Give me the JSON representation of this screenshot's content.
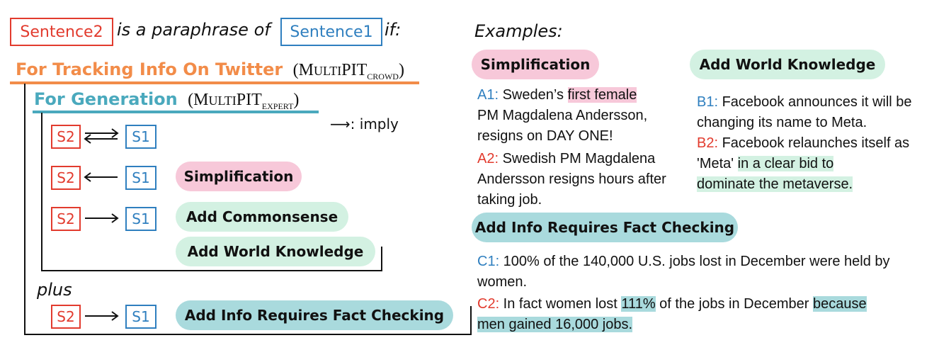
{
  "title": {
    "sentence2": "Sentence2",
    "middle": "is a paraphrase of",
    "sentence1": "Sentence1",
    "end": "if:"
  },
  "twitter": {
    "label": "For Tracking Info On Twitter",
    "paren_open": "(",
    "name_big": "M",
    "name_small": "ULTI",
    "name_rest": "PIT",
    "sub": "CROWD",
    "paren_close": ")"
  },
  "generation": {
    "label": "For Generation",
    "paren_open": "(",
    "name_big": "M",
    "name_small": "ULTI",
    "name_rest": "PIT",
    "sub": "EXPERT",
    "paren_close": ")"
  },
  "legend": {
    "arrow": "⟶",
    "text": ": imply"
  },
  "s2": "S2",
  "s1": "S1",
  "rules": {
    "simplification": "Simplification",
    "commonsense": "Add Commonsense",
    "world_knowledge": "Add World Knowledge",
    "fact_checking": "Add Info Requires Fact Checking"
  },
  "plus": "plus",
  "examples": {
    "heading": "Examples:",
    "simplification_label": "Simplification",
    "world_knowledge_label": "Add World Knowledge",
    "fact_checking_label": "Add Info Requires Fact Checking",
    "a1_label": "A1:",
    "a1_pre": " Sweden’s ",
    "a1_hl": "first female",
    "a1_post": "PM Magdalena Andersson, resigns on DAY ONE!",
    "a2_label": "A2:",
    "a2_text": " Swedish PM Magdalena Andersson resigns hours after taking job.",
    "b1_label": "B1:",
    "b1_text": " Facebook announces it will be changing its name to Meta.",
    "b2_label": "B2:",
    "b2_pre": " Facebook relaunches itself as 'Meta' ",
    "b2_hl1": "in a clear bid to",
    "b2_hl2": "dominate the metaverse.",
    "c1_label": "C1:",
    "c1_text": " 100% of the 140,000 U.S. jobs lost in December were held by women.",
    "c2_label": "C2:",
    "c2_pre": " In fact women lost ",
    "c2_hl1": "111%",
    "c2_mid": " of the jobs in December ",
    "c2_hl2": "because",
    "c2_hl3": "men gained 16,000 jobs."
  },
  "colors": {
    "red": "#e23b2e",
    "blue": "#2f7fbf",
    "orange": "#f28c49",
    "teal_text": "#4aa9bd",
    "pink": "#f7c8d9",
    "green": "#d3f1e2",
    "teal": "#a9dadd"
  }
}
